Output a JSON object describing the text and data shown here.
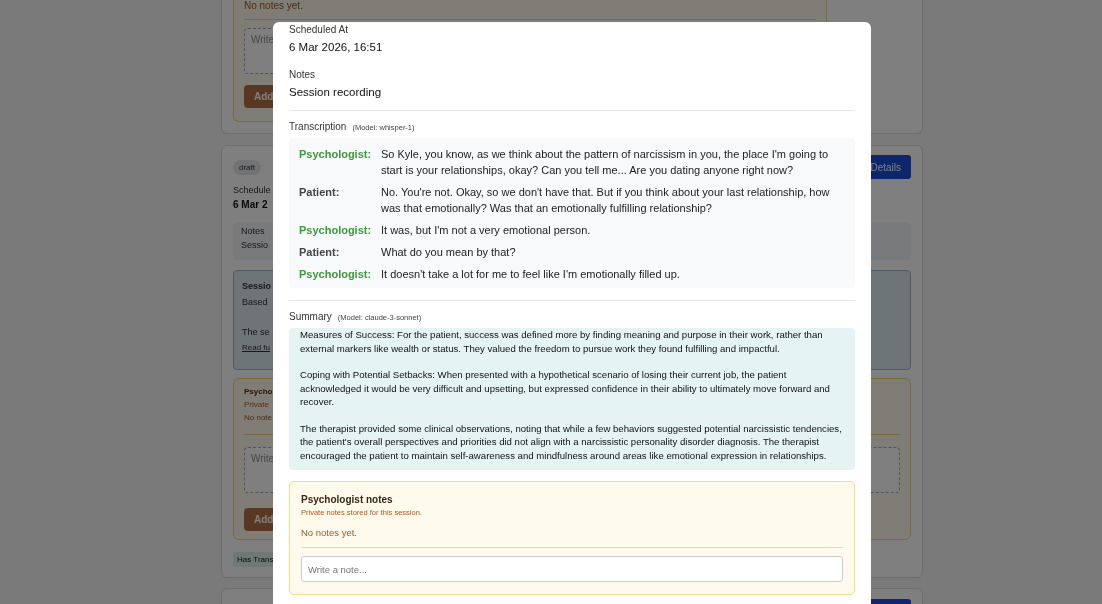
{
  "background": {
    "card_top": {
      "empty_text": "No notes yet.",
      "note_placeholder": "Write",
      "add_button": "Add"
    },
    "card_session": {
      "status": "draft",
      "scheduled_label": "Schedule",
      "scheduled_value": "6 Mar 2",
      "details_button": "Details",
      "notes_label": "Notes",
      "notes_value": "Sessio",
      "summary_title": "Sessio",
      "summary_line": "Based",
      "summary_text": "The se",
      "summary_link": "Read fu",
      "psych_title": "Psycho",
      "psych_subtitle": "Private",
      "psych_empty": "No note",
      "note_placeholder": "Write",
      "add_button": "Add",
      "badge": "Has Trans"
    }
  },
  "modal": {
    "scheduled_label": "Scheduled At",
    "scheduled_value": "6 Mar 2026, 16:51",
    "notes_label": "Notes",
    "notes_value": "Session recording",
    "transcription": {
      "title": "Transcription",
      "model": "(Model: whisper-1)",
      "lines": [
        {
          "kind": "psychologist",
          "speaker": "Psychologist:",
          "text": "So Kyle, you know, as we think about the pattern of narcissism in you, the place I'm going to start is your relationships, okay? Can you tell me... Are you dating anyone right now?"
        },
        {
          "kind": "patient",
          "speaker": "Patient:",
          "text": "No. You're not. Okay, so we don't have that. But if you think about your last relationship, how was that emotionally? Was that an emotionally fulfilling relationship?"
        },
        {
          "kind": "psychologist",
          "speaker": "Psychologist:",
          "text": "It was, but I'm not a very emotional person."
        },
        {
          "kind": "patient",
          "speaker": "Patient:",
          "text": "What do you mean by that?"
        },
        {
          "kind": "psychologist",
          "speaker": "Psychologist:",
          "text": "It doesn't take a lot for me to feel like I'm emotionally filled up."
        }
      ]
    },
    "summary": {
      "title": "Summary",
      "model": "(Model: claude-3-sonnet)",
      "paragraphs": [
        "Measures of Success: For the patient, success was defined more by finding meaning and purpose in their work, rather than external markers like wealth or status. They valued the freedom to pursue work they found fulfilling and impactful.",
        "Coping with Potential Setbacks: When presented with a hypothetical scenario of losing their current job, the patient acknowledged it would be very difficult and upsetting, but expressed confidence in their ability to ultimately move forward and recover.",
        "The therapist provided some clinical observations, noting that while a few behaviors suggested potential narcissistic tendencies, the patient's overall perspectives and priorities did not align with a narcissistic personality disorder diagnosis. The therapist encouraged the patient to maintain self-awareness and mindfulness around areas like emotional expression in relationships."
      ]
    },
    "psych_notes": {
      "title": "Psychologist notes",
      "subtitle": "Private notes stored for this session.",
      "empty_text": "No notes yet.",
      "note_placeholder": "Write a note..."
    }
  }
}
